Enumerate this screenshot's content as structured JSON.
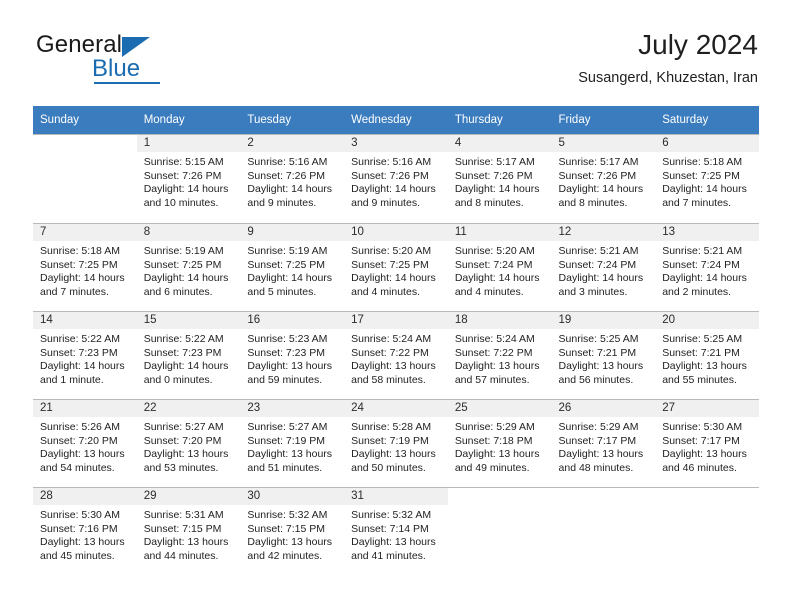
{
  "brand": {
    "name_top": "General",
    "name_bottom": "Blue",
    "accent_color": "#1b6cb0"
  },
  "header": {
    "title": "July 2024",
    "subtitle": "Susangerd, Khuzestan, Iran"
  },
  "theme": {
    "header_row_bg": "#3a7cbe",
    "header_row_text": "#ffffff",
    "daynum_bg": "#f0f0f0",
    "grid_line": "#b9b9b9"
  },
  "weekdays": [
    "Sunday",
    "Monday",
    "Tuesday",
    "Wednesday",
    "Thursday",
    "Friday",
    "Saturday"
  ],
  "labels": {
    "sunrise_prefix": "Sunrise:",
    "sunset_prefix": "Sunset:",
    "daylight_prefix": "Daylight:"
  },
  "weeks": [
    [
      {
        "empty": true
      },
      {
        "day": "1",
        "sunrise": "Sunrise: 5:15 AM",
        "sunset": "Sunset: 7:26 PM",
        "daylight1": "Daylight: 14 hours",
        "daylight2": "and 10 minutes."
      },
      {
        "day": "2",
        "sunrise": "Sunrise: 5:16 AM",
        "sunset": "Sunset: 7:26 PM",
        "daylight1": "Daylight: 14 hours",
        "daylight2": "and 9 minutes."
      },
      {
        "day": "3",
        "sunrise": "Sunrise: 5:16 AM",
        "sunset": "Sunset: 7:26 PM",
        "daylight1": "Daylight: 14 hours",
        "daylight2": "and 9 minutes."
      },
      {
        "day": "4",
        "sunrise": "Sunrise: 5:17 AM",
        "sunset": "Sunset: 7:26 PM",
        "daylight1": "Daylight: 14 hours",
        "daylight2": "and 8 minutes."
      },
      {
        "day": "5",
        "sunrise": "Sunrise: 5:17 AM",
        "sunset": "Sunset: 7:26 PM",
        "daylight1": "Daylight: 14 hours",
        "daylight2": "and 8 minutes."
      },
      {
        "day": "6",
        "sunrise": "Sunrise: 5:18 AM",
        "sunset": "Sunset: 7:25 PM",
        "daylight1": "Daylight: 14 hours",
        "daylight2": "and 7 minutes."
      }
    ],
    [
      {
        "day": "7",
        "sunrise": "Sunrise: 5:18 AM",
        "sunset": "Sunset: 7:25 PM",
        "daylight1": "Daylight: 14 hours",
        "daylight2": "and 7 minutes."
      },
      {
        "day": "8",
        "sunrise": "Sunrise: 5:19 AM",
        "sunset": "Sunset: 7:25 PM",
        "daylight1": "Daylight: 14 hours",
        "daylight2": "and 6 minutes."
      },
      {
        "day": "9",
        "sunrise": "Sunrise: 5:19 AM",
        "sunset": "Sunset: 7:25 PM",
        "daylight1": "Daylight: 14 hours",
        "daylight2": "and 5 minutes."
      },
      {
        "day": "10",
        "sunrise": "Sunrise: 5:20 AM",
        "sunset": "Sunset: 7:25 PM",
        "daylight1": "Daylight: 14 hours",
        "daylight2": "and 4 minutes."
      },
      {
        "day": "11",
        "sunrise": "Sunrise: 5:20 AM",
        "sunset": "Sunset: 7:24 PM",
        "daylight1": "Daylight: 14 hours",
        "daylight2": "and 4 minutes."
      },
      {
        "day": "12",
        "sunrise": "Sunrise: 5:21 AM",
        "sunset": "Sunset: 7:24 PM",
        "daylight1": "Daylight: 14 hours",
        "daylight2": "and 3 minutes."
      },
      {
        "day": "13",
        "sunrise": "Sunrise: 5:21 AM",
        "sunset": "Sunset: 7:24 PM",
        "daylight1": "Daylight: 14 hours",
        "daylight2": "and 2 minutes."
      }
    ],
    [
      {
        "day": "14",
        "sunrise": "Sunrise: 5:22 AM",
        "sunset": "Sunset: 7:23 PM",
        "daylight1": "Daylight: 14 hours",
        "daylight2": "and 1 minute."
      },
      {
        "day": "15",
        "sunrise": "Sunrise: 5:22 AM",
        "sunset": "Sunset: 7:23 PM",
        "daylight1": "Daylight: 14 hours",
        "daylight2": "and 0 minutes."
      },
      {
        "day": "16",
        "sunrise": "Sunrise: 5:23 AM",
        "sunset": "Sunset: 7:23 PM",
        "daylight1": "Daylight: 13 hours",
        "daylight2": "and 59 minutes."
      },
      {
        "day": "17",
        "sunrise": "Sunrise: 5:24 AM",
        "sunset": "Sunset: 7:22 PM",
        "daylight1": "Daylight: 13 hours",
        "daylight2": "and 58 minutes."
      },
      {
        "day": "18",
        "sunrise": "Sunrise: 5:24 AM",
        "sunset": "Sunset: 7:22 PM",
        "daylight1": "Daylight: 13 hours",
        "daylight2": "and 57 minutes."
      },
      {
        "day": "19",
        "sunrise": "Sunrise: 5:25 AM",
        "sunset": "Sunset: 7:21 PM",
        "daylight1": "Daylight: 13 hours",
        "daylight2": "and 56 minutes."
      },
      {
        "day": "20",
        "sunrise": "Sunrise: 5:25 AM",
        "sunset": "Sunset: 7:21 PM",
        "daylight1": "Daylight: 13 hours",
        "daylight2": "and 55 minutes."
      }
    ],
    [
      {
        "day": "21",
        "sunrise": "Sunrise: 5:26 AM",
        "sunset": "Sunset: 7:20 PM",
        "daylight1": "Daylight: 13 hours",
        "daylight2": "and 54 minutes."
      },
      {
        "day": "22",
        "sunrise": "Sunrise: 5:27 AM",
        "sunset": "Sunset: 7:20 PM",
        "daylight1": "Daylight: 13 hours",
        "daylight2": "and 53 minutes."
      },
      {
        "day": "23",
        "sunrise": "Sunrise: 5:27 AM",
        "sunset": "Sunset: 7:19 PM",
        "daylight1": "Daylight: 13 hours",
        "daylight2": "and 51 minutes."
      },
      {
        "day": "24",
        "sunrise": "Sunrise: 5:28 AM",
        "sunset": "Sunset: 7:19 PM",
        "daylight1": "Daylight: 13 hours",
        "daylight2": "and 50 minutes."
      },
      {
        "day": "25",
        "sunrise": "Sunrise: 5:29 AM",
        "sunset": "Sunset: 7:18 PM",
        "daylight1": "Daylight: 13 hours",
        "daylight2": "and 49 minutes."
      },
      {
        "day": "26",
        "sunrise": "Sunrise: 5:29 AM",
        "sunset": "Sunset: 7:17 PM",
        "daylight1": "Daylight: 13 hours",
        "daylight2": "and 48 minutes."
      },
      {
        "day": "27",
        "sunrise": "Sunrise: 5:30 AM",
        "sunset": "Sunset: 7:17 PM",
        "daylight1": "Daylight: 13 hours",
        "daylight2": "and 46 minutes."
      }
    ],
    [
      {
        "day": "28",
        "sunrise": "Sunrise: 5:30 AM",
        "sunset": "Sunset: 7:16 PM",
        "daylight1": "Daylight: 13 hours",
        "daylight2": "and 45 minutes."
      },
      {
        "day": "29",
        "sunrise": "Sunrise: 5:31 AM",
        "sunset": "Sunset: 7:15 PM",
        "daylight1": "Daylight: 13 hours",
        "daylight2": "and 44 minutes."
      },
      {
        "day": "30",
        "sunrise": "Sunrise: 5:32 AM",
        "sunset": "Sunset: 7:15 PM",
        "daylight1": "Daylight: 13 hours",
        "daylight2": "and 42 minutes."
      },
      {
        "day": "31",
        "sunrise": "Sunrise: 5:32 AM",
        "sunset": "Sunset: 7:14 PM",
        "daylight1": "Daylight: 13 hours",
        "daylight2": "and 41 minutes."
      },
      {
        "empty": true
      },
      {
        "empty": true
      },
      {
        "empty": true
      }
    ]
  ]
}
